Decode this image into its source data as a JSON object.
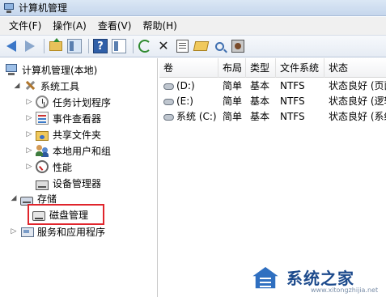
{
  "window": {
    "title": "计算机管理"
  },
  "menu": [
    {
      "label": "文件(F)"
    },
    {
      "label": "操作(A)"
    },
    {
      "label": "查看(V)"
    },
    {
      "label": "帮助(H)"
    }
  ],
  "toolbar": {
    "icons": [
      "back-icon",
      "forward-icon",
      "up-icon",
      "show-hide-tree-icon",
      "help-icon",
      "console-tree-icon",
      "refresh-icon",
      "delete-icon",
      "properties-icon",
      "open-icon",
      "search-icon",
      "disk-tool-icon"
    ]
  },
  "tree": {
    "root": "计算机管理(本地)",
    "system_tools": "系统工具",
    "task_scheduler": "任务计划程序",
    "event_viewer": "事件查看器",
    "shared_folders": "共享文件夹",
    "local_users": "本地用户和组",
    "performance": "性能",
    "device_manager": "设备管理器",
    "storage": "存储",
    "disk_management": "磁盘管理",
    "services_apps": "服务和应用程序"
  },
  "volumes": {
    "columns": [
      "卷",
      "布局",
      "类型",
      "文件系统",
      "状态"
    ],
    "rows": [
      {
        "volume": "(D:)",
        "layout": "简单",
        "type": "基本",
        "fs": "NTFS",
        "status": "状态良好 (页面"
      },
      {
        "volume": "(E:)",
        "layout": "简单",
        "type": "基本",
        "fs": "NTFS",
        "status": "状态良好 (逻辑"
      },
      {
        "volume": "系统 (C:)",
        "layout": "简单",
        "type": "基本",
        "fs": "NTFS",
        "status": "状态良好 (系统"
      }
    ]
  },
  "watermark": {
    "text": "系统之家",
    "url": "www.xitongzhijia.net"
  },
  "colors": {
    "highlight": "#e0252c",
    "selection": "#3b77c8"
  }
}
